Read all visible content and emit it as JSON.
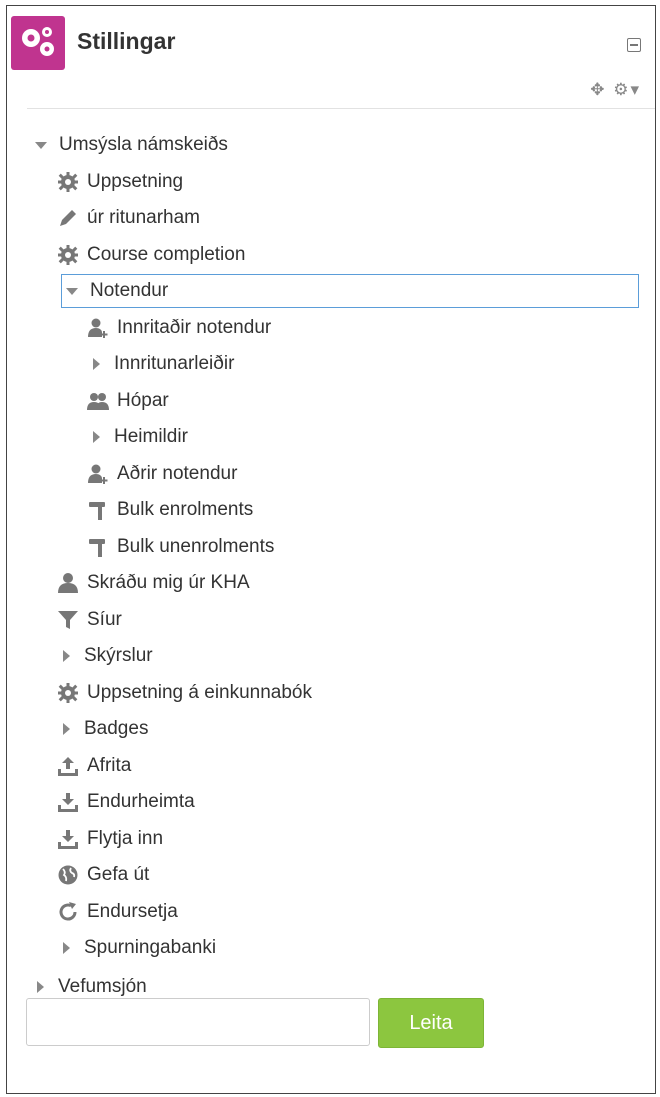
{
  "header": {
    "title": "Stillingar",
    "logo_icon": "gears-icon",
    "accent": "#c0348f"
  },
  "tree": {
    "root_label": "Umsýsla námskeiðs",
    "items": [
      {
        "label": "Uppsetning",
        "icon": "gear-icon"
      },
      {
        "label": "úr ritunarham",
        "icon": "pencil-icon"
      },
      {
        "label": "Course completion",
        "icon": "gear-icon"
      },
      {
        "label": "Notendur",
        "icon": "caret-down-icon"
      },
      {
        "label": "Innritaðir notendur",
        "icon": "user-add-icon"
      },
      {
        "label": "Innritunarleiðir",
        "icon": "caret-right-icon"
      },
      {
        "label": "Hópar",
        "icon": "users-icon"
      },
      {
        "label": "Heimildir",
        "icon": "caret-right-icon"
      },
      {
        "label": "Aðrir notendur",
        "icon": "user-add-icon"
      },
      {
        "label": "Bulk enrolments",
        "icon": "hammer-icon"
      },
      {
        "label": "Bulk unenrolments",
        "icon": "hammer-icon"
      },
      {
        "label": "Skráðu mig úr KHA",
        "icon": "user-icon"
      },
      {
        "label": "Síur",
        "icon": "filter-icon"
      },
      {
        "label": "Skýrslur",
        "icon": "caret-right-icon"
      },
      {
        "label": "Uppsetning á einkunnabók",
        "icon": "gear-icon"
      },
      {
        "label": "Badges",
        "icon": "caret-right-icon"
      },
      {
        "label": "Afrita",
        "icon": "upload-icon"
      },
      {
        "label": "Endurheimta",
        "icon": "download-icon"
      },
      {
        "label": "Flytja inn",
        "icon": "download-icon"
      },
      {
        "label": "Gefa út",
        "icon": "globe-icon"
      },
      {
        "label": "Endursetja",
        "icon": "refresh-icon"
      },
      {
        "label": "Spurningabanki",
        "icon": "caret-right-icon"
      }
    ],
    "site_admin_label": "Vefumsjón"
  },
  "search": {
    "value": "",
    "placeholder": "",
    "button_label": "Leita",
    "button_color": "#8cc63f"
  }
}
